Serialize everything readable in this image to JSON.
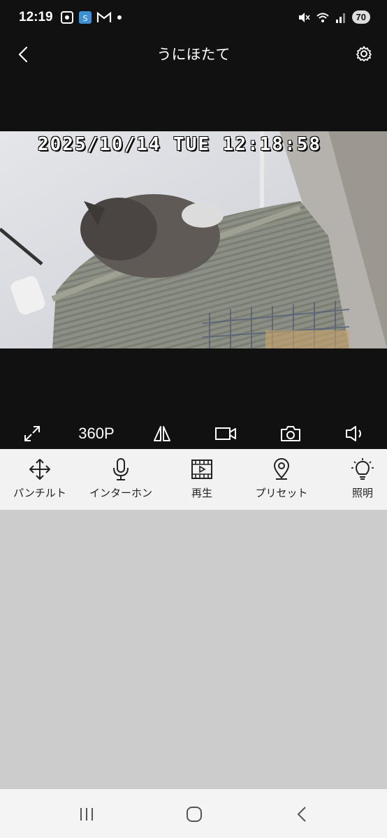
{
  "status_bar": {
    "time": "12:19",
    "notification_icons": [
      "screenshot-icon",
      "app-icon",
      "gmail-icon",
      "dot-icon"
    ],
    "system_icons": [
      "mute-icon",
      "wifi-icon",
      "signal-icon"
    ],
    "battery": "70"
  },
  "header": {
    "title": "うにほたて",
    "back_icon": "chevron-left-icon",
    "settings_icon": "gear-icon"
  },
  "video": {
    "timestamp": "2025/10/14 TUE 12:18:58"
  },
  "controls": {
    "quality_label": "360P",
    "icons": [
      "fullscreen-icon",
      "mirror-icon",
      "record-icon",
      "camera-icon",
      "speaker-icon"
    ]
  },
  "toolbar": {
    "items": [
      {
        "label": "パンチルト",
        "icon": "move-arrows-icon"
      },
      {
        "label": "インターホン",
        "icon": "microphone-icon"
      },
      {
        "label": "再生",
        "icon": "film-icon"
      },
      {
        "label": "プリセット",
        "icon": "location-pin-icon"
      },
      {
        "label": "照明",
        "icon": "light-bulb-icon"
      }
    ]
  },
  "colors": {
    "dark_bg": "#111111",
    "toolbar_bg": "#f2f2f2",
    "content_bg": "#cccccc",
    "nav_bg": "#f4f4f4"
  },
  "navigation": {
    "icons": [
      "recent-apps-icon",
      "home-icon",
      "back-icon"
    ]
  }
}
